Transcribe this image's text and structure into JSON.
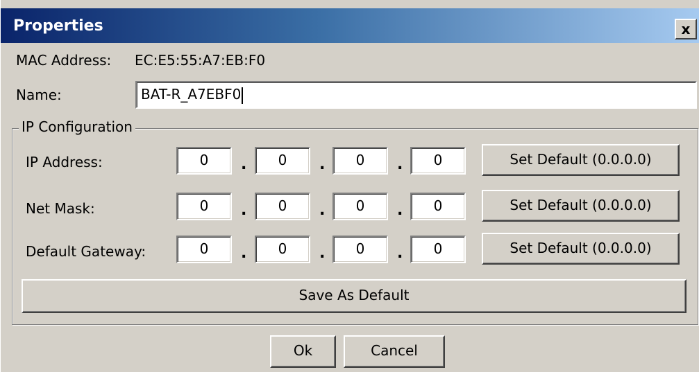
{
  "window": {
    "title": "Properties",
    "close_label": "x"
  },
  "mac": {
    "label": "MAC Address:",
    "value": "EC:E5:55:A7:EB:F0"
  },
  "name": {
    "label": "Name:",
    "value": "BAT-R_A7EBF0"
  },
  "ip_config": {
    "group_title": "IP Configuration",
    "separator": ".",
    "rows": [
      {
        "label": "IP Address:",
        "octets": [
          "0",
          "0",
          "0",
          "0"
        ],
        "button": "Set Default (0.0.0.0)"
      },
      {
        "label": "Net Mask:",
        "octets": [
          "0",
          "0",
          "0",
          "0"
        ],
        "button": "Set Default (0.0.0.0)"
      },
      {
        "label": "Default Gateway:",
        "octets": [
          "0",
          "0",
          "0",
          "0"
        ],
        "button": "Set Default (0.0.0.0)"
      }
    ],
    "save_default_label": "Save As Default"
  },
  "footer": {
    "ok_label": "Ok",
    "cancel_label": "Cancel"
  },
  "colors": {
    "title_gradient_start": "#0a246a",
    "title_gradient_end": "#a6caf0",
    "dialog_face": "#d4d0c8"
  }
}
